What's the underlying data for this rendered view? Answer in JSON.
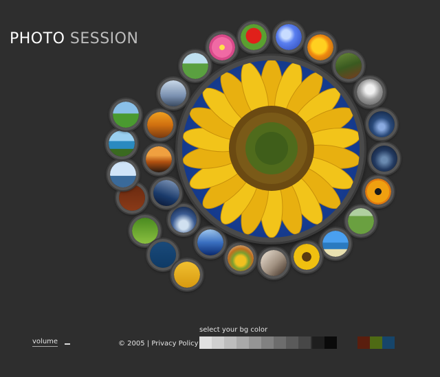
{
  "site": {
    "title_part1": "PHOTO",
    "title_part2": "SESSION"
  },
  "main_photo": {
    "name": "sunflower"
  },
  "thumbnails": [
    {
      "name": "pink-flower"
    },
    {
      "name": "red-tulip"
    },
    {
      "name": "blue-sky"
    },
    {
      "name": "yellow-lilies"
    },
    {
      "name": "forest-path"
    },
    {
      "name": "bride-portrait"
    },
    {
      "name": "night-sky"
    },
    {
      "name": "dark-landscape"
    },
    {
      "name": "butterfly"
    },
    {
      "name": "green-valley"
    },
    {
      "name": "tropical-beach"
    },
    {
      "name": "sunflower-small"
    },
    {
      "name": "couple-sofa"
    },
    {
      "name": "fruit-bowl"
    },
    {
      "name": "clouds"
    },
    {
      "name": "tree-silhouette"
    },
    {
      "name": "blue-landscape"
    },
    {
      "name": "sunset"
    },
    {
      "name": "golden-field"
    },
    {
      "name": "grey-sky"
    },
    {
      "name": "palm-tree"
    },
    {
      "name": "brown-page"
    },
    {
      "name": "green-page"
    },
    {
      "name": "blue-page"
    },
    {
      "name": "yellow-page"
    },
    {
      "name": "lighthouse"
    },
    {
      "name": "coastline"
    },
    {
      "name": "green-meadow"
    }
  ],
  "footer": {
    "volume_label": "volume",
    "copyright": "© 2005 |",
    "privacy_link": "Privacy Policy",
    "bg_color_label": "select your bg color"
  },
  "bg_colors": [
    "#e0e0e0",
    "#cfcfcf",
    "#bdbdbd",
    "#a9a9a9",
    "#959595",
    "#818181",
    "#6d6d6d",
    "#5a5a5a",
    "#474747",
    "#1e1e1e",
    "#0a0a0a",
    "#5a1e0e",
    "#4e6a14",
    "#16456a"
  ]
}
